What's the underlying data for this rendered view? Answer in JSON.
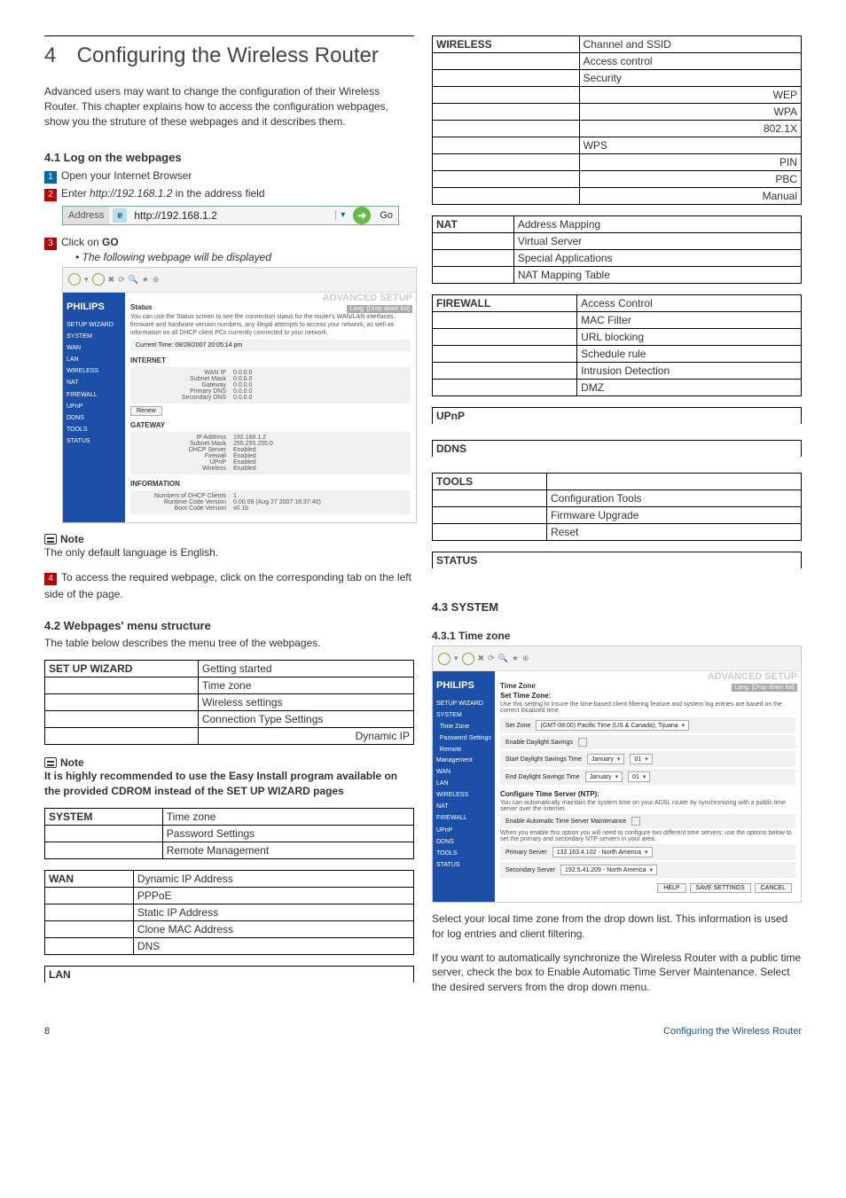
{
  "chapter_num": "4",
  "chapter_title": "Configuring the Wireless Router",
  "intro": "Advanced users may want to change the configuration of their Wireless Router. This chapter explains how to access the configuration webpages, show you the struture of these webpages and it describes them.",
  "s41": {
    "hd": "4.1   Log on the webpages",
    "step1": "Open your Internet Browser",
    "step2_a": "Enter ",
    "step2_url": "http://192.168.1.2",
    "step2_b": " in the address field",
    "addr_label": "Address",
    "addr_url": "http://192.168.1.2",
    "addr_go": "Go",
    "step3_a": "Click on ",
    "step3_b": "GO",
    "step3_sub": "The following webpage will be displayed"
  },
  "shot1": {
    "brand": "PHILIPS",
    "adv": "ADVANCED SETUP",
    "lang": "Lang: [Drop down list]",
    "side": [
      "SETUP WIZARD",
      "SYSTEM",
      "WAN",
      "LAN",
      "WIRELESS",
      "NAT",
      "FIREWALL",
      "UPnP",
      "DDNS",
      "TOOLS",
      "STATUS"
    ],
    "status_t": "Status",
    "status_txt": "You can use the Status screen to see the connection status for the router's WAN/LAN interfaces, firmware and hardware version numbers, any illegal attempts to access your network, as well as information on all DHCP client PCs currently connected to your network.",
    "curtime": "Current Time:  08/28/2007 20:05:14 pm",
    "inet_t": "INTERNET",
    "inet": [
      [
        "WAN IP",
        "0.0.0.0"
      ],
      [
        "Subnet Mask",
        "0.0.0.0"
      ],
      [
        "Gateway",
        "0.0.0.0"
      ],
      [
        "Primary DNS",
        "0.0.0.0"
      ],
      [
        "Secondary DNS",
        "0.0.0.0"
      ]
    ],
    "renew": "Renew",
    "gw_t": "GATEWAY",
    "gw": [
      [
        "IP Address",
        "192.168.1.2"
      ],
      [
        "Subnet Mask",
        "255.255.255.0"
      ],
      [
        "DHCP Server",
        "Enabled"
      ],
      [
        "Firewall",
        "Enabled"
      ],
      [
        "UPnP",
        "Enabled"
      ],
      [
        "Wireless",
        "Enabled"
      ]
    ],
    "info_t": "INFORMATION",
    "info": [
      [
        "Numbers of DHCP Clients",
        "1"
      ],
      [
        "Runtime Code Version",
        "0.00.09 (Aug 27 2007 18:37:40)"
      ],
      [
        "Boot Code Version",
        "v0.1b"
      ]
    ]
  },
  "note1_t": "Note",
  "note1_body": "The only default language is English.",
  "step4": "To access the required webpage, click on the corresponding tab on the left side of the page.",
  "s42": {
    "hd": "4.2   Webpages' menu structure",
    "intro": "The table below describes the menu tree of the webpages."
  },
  "tables": {
    "setup_h": "SET UP WIZARD",
    "setup": [
      "Getting started",
      "Time zone",
      "Wireless settings",
      "Connection Type Settings",
      "Dynamic IP"
    ],
    "system_h": "SYSTEM",
    "system": [
      "Time zone",
      "Password Settings",
      "Remote Management"
    ],
    "wan_h": "WAN",
    "wan": [
      "Dynamic IP Address",
      "PPPoE",
      "Static IP Address",
      "Clone MAC Address",
      "DNS"
    ],
    "lan_h": "LAN",
    "wireless_h": "WIRELESS",
    "wireless": [
      "Channel and SSID",
      "Access control",
      "Security",
      "WEP",
      "WPA",
      "802.1X",
      "WPS",
      "PIN",
      "PBC",
      "Manual"
    ],
    "nat_h": "NAT",
    "nat": [
      "Address Mapping",
      "Virtual Server",
      "Special Applications",
      "NAT Mapping Table"
    ],
    "fw_h": "FIREWALL",
    "fw": [
      "Access Control",
      "MAC Filter",
      "URL blocking",
      "Schedule rule",
      "Intrusion Detection",
      "DMZ"
    ],
    "upnp_h": "UPnP",
    "ddns_h": "DDNS",
    "tools_h": "TOOLS",
    "tools": [
      "Configuration Tools",
      "Firmware Upgrade",
      "Reset"
    ],
    "status_h": "STATUS"
  },
  "note2_t": "Note",
  "note2_body": "It is highly recommended to use the Easy Install program available on the provided CDROM instead of the SET UP WIZARD pages",
  "s43": {
    "hd": "4.3   SYSTEM"
  },
  "s431": {
    "hd": "4.3.1   Time zone"
  },
  "tz": {
    "title": "Time Zone",
    "sub": "Set Time Zone:",
    "desc": "Use this setting to insure the time-based client filtering feature and system log entries are based on the correct localized time.",
    "tz_lbl": "Set Zone",
    "tz_val": "(GMT-08:00) Pacific Time (US & Canada); Tijuana",
    "ds_lbl": "Enable Daylight Savings",
    "dsstart": "Start Daylight Savings Time",
    "dsend": "End Daylight Savings Time",
    "month": "January",
    "day1": "01",
    "day2": "01",
    "cts": "Configure Time Server (NTP):",
    "cts_desc": "You can automatically maintain the system time on your ADSL router by synchronizing with a public time server over the Internet.",
    "auto": "Enable Automatic Time Server Maintenance",
    "auto_desc": "When you enable this option you will need to configure two different time servers; use the options below to set the primary and secondary NTP servers in your area.",
    "p_lbl": "Primary Server",
    "p_val": "132.163.4.102 - North America",
    "s_lbl": "Secondary Server",
    "s_val": "192.5.41.209 - North America",
    "help": "HELP",
    "save": "SAVE SETTINGS",
    "cancel": "CANCEL"
  },
  "body1": "Select your local time zone from the drop down list. This information is used for log entries and client filtering.",
  "body2": "If you want to automatically synchronize the Wireless Router with a public time server, check the box to Enable Automatic Time Server Maintenance. Select the desired servers from the drop down menu.",
  "footer": {
    "page": "8",
    "title": "Configuring the Wireless Router"
  }
}
